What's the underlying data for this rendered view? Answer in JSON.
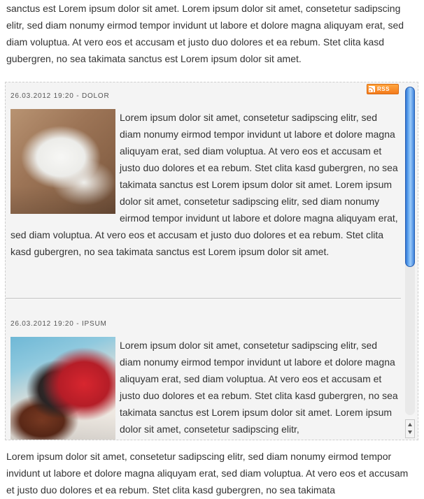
{
  "page": {
    "top_paragraph": "sanctus est Lorem ipsum dolor sit amet. Lorem ipsum dolor sit amet, consetetur sadipscing elitr, sed diam nonumy eirmod tempor invidunt ut labore et dolore magna aliquyam erat, sed diam voluptua. At vero eos et accusam et justo duo dolores et ea rebum. Stet clita kasd gubergren, no sea takimata sanctus est Lorem ipsum dolor sit amet.",
    "bottom_paragraph": "Lorem ipsum dolor sit amet, consetetur sadipscing elitr, sed diam nonumy eirmod tempor invidunt ut labore et dolore magna aliquyam erat, sed diam voluptua. At vero eos et accusam et justo duo dolores et ea rebum. Stet clita kasd gubergren, no sea takimata"
  },
  "feed": {
    "rss_label": "RSS",
    "rss_icon": "rss-feed-icon",
    "rss_color": "#f47b1c",
    "scroll_thumb_color": "#4a90e2",
    "entries": [
      {
        "meta": "26.03.2012 19:20 - DOLOR",
        "image_alt": "white kitten",
        "body": "Lorem ipsum dolor sit amet, consetetur sadipscing elitr, sed diam nonumy eirmod tempor invidunt ut labore et dolore magna aliquyam erat, sed diam voluptua. At vero eos et accusam et justo duo dolores et ea rebum. Stet clita kasd gubergren, no sea takimata sanctus est Lorem ipsum dolor sit amet. Lorem ipsum dolor sit amet, consetetur sadipscing elitr, sed diam nonumy eirmod tempor invidunt ut labore et dolore magna aliquyam erat, sed diam voluptua. At vero eos et accusam et justo duo dolores et ea rebum. Stet clita kasd gubergren, no sea takimata sanctus est Lorem ipsum dolor sit amet."
      },
      {
        "meta": "26.03.2012 19:20 - IPSUM",
        "image_alt": "black cat with teddy bear",
        "body": "Lorem ipsum dolor sit amet, consetetur sadipscing elitr, sed diam nonumy eirmod tempor invidunt ut labore et dolore magna aliquyam erat, sed diam voluptua. At vero eos et accusam et justo duo dolores et ea rebum. Stet clita kasd gubergren, no sea takimata sanctus est Lorem ipsum dolor sit amet. Lorem ipsum dolor sit amet, consetetur sadipscing elitr,"
      }
    ]
  }
}
